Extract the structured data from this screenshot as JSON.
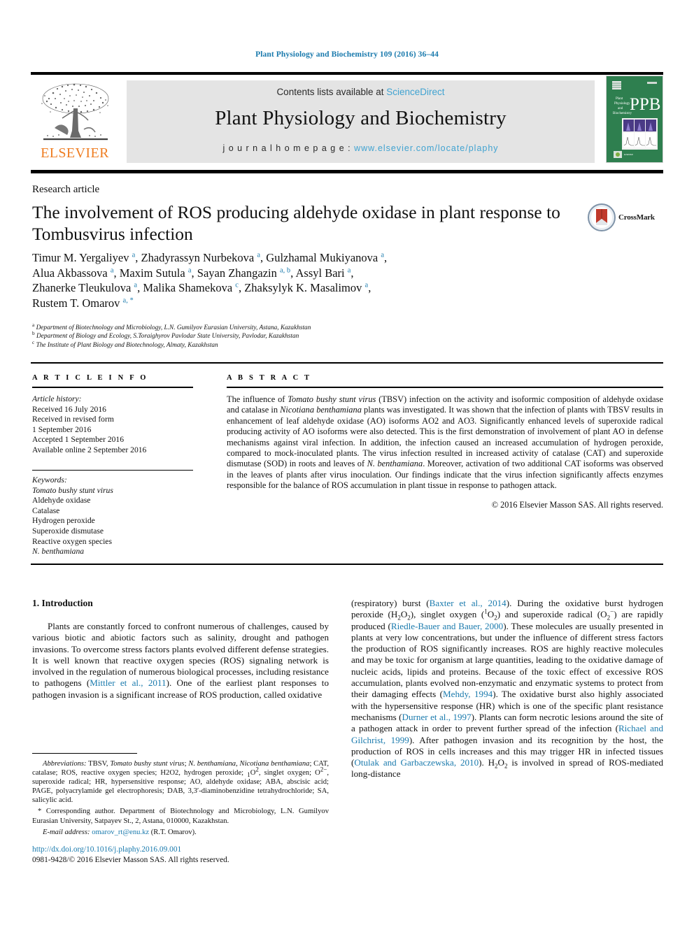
{
  "running_head": "Plant Physiology and Biochemistry 109 (2016) 36–44",
  "masthead": {
    "publisher_name": "ELSEVIER",
    "contents_prefix": "Contents lists available at ",
    "contents_link": "ScienceDirect",
    "journal_title": "Plant Physiology and Biochemistry",
    "homepage_prefix": "j o u r n a l   h o m e p a g e :  ",
    "homepage_url": "www.elsevier.com/locate/plaphy",
    "cover_abbrev": "PPB",
    "cover_subtitle": "Plant Physiology and Biochemistry"
  },
  "article": {
    "type": "Research article",
    "title": "The involvement of ROS producing aldehyde oxidase in plant response to Tombusvirus infection",
    "crossmark_label": "CrossMark",
    "authors_html": "Timur M. Yergaliyev <sup>a</sup>, Zhadyrassyn Nurbekova <sup>a</sup>, Gulzhamal Mukiyanova <sup>a</sup>,<br>Alua Akbassova <sup>a</sup>, Maxim Sutula <sup>a</sup>, Sayan Zhangazin <sup>a, b</sup>, Assyl Bari <sup>a</sup>,<br>Zhanerke Tleukulova <sup>a</sup>, Malika Shamekova <sup>c</sup>, Zhaksylyk K. Masalimov <sup>a</sup>,<br>Rustem T. Omarov <sup>a, *</sup>",
    "affiliations": [
      {
        "marker": "a",
        "text": "Department of Biotechnology and Microbiology, L.N. Gumilyov Eurasian University, Astana, Kazakhstan"
      },
      {
        "marker": "b",
        "text": "Department of Biology and Ecology, S.Toraighyrov Pavlodar State University, Pavlodar, Kazakhstan"
      },
      {
        "marker": "c",
        "text": "The Institute of Plant Biology and Biotechnology, Almaty, Kazakhstan"
      }
    ]
  },
  "article_info": {
    "heading": "A R T I C L E  I N F O",
    "history_label": "Article history:",
    "history": [
      "Received 16 July 2016",
      "Received in revised form",
      "1 September 2016",
      "Accepted 1 September 2016",
      "Available online 2 September 2016"
    ],
    "keywords_label": "Keywords:",
    "keywords": [
      "Tomato bushy stunt virus",
      "Aldehyde oxidase",
      "Catalase",
      "Hydrogen peroxide",
      "Superoxide dismutase",
      "Reactive oxygen species",
      "N. benthamiana"
    ]
  },
  "abstract": {
    "heading": "A B S T R A C T",
    "text_html": "The influence of <i>Tomato bushy stunt virus</i> (TBSV) infection on the activity and isoformic composition of aldehyde oxidase and catalase in <i>Nicotiana benthamiana</i> plants was investigated. It was shown that the infection of plants with TBSV results in enhancement of leaf aldehyde oxidase (AO) isoforms AO2 and AO3. Significantly enhanced levels of superoxide radical producing activity of AO isoforms were also detected. This is the first demonstration of involvement of plant AO in defense mechanisms against viral infection. In addition, the infection caused an increased accumulation of hydrogen peroxide, compared to mock-inoculated plants. The virus infection resulted in increased activity of catalase (CAT) and superoxide dismutase (SOD) in roots and leaves of <i>N. benthamiana</i>. Moreover, activation of two additional CAT isoforms was observed in the leaves of plants after virus inoculation. Our findings indicate that the virus infection significantly affects enzymes responsible for the balance of ROS accumulation in plant tissue in response to pathogen attack.",
    "copyright": "© 2016 Elsevier Masson SAS. All rights reserved."
  },
  "body": {
    "section_title": "1. Introduction",
    "left_paragraph_html": "Plants are constantly forced to confront numerous of challenges, caused by various biotic and abiotic factors such as salinity, drought and pathogen invasions. To overcome stress factors plants evolved different defense strategies. It is well known that reactive oxygen species (ROS) signaling network is involved in the regulation of numerous biological processes, including resistance to pathogens (<span class=\"ref\">Mittler et al., 2011</span>). One of the earliest plant responses to pathogen invasion is a significant increase of ROS production, called oxidative",
    "right_paragraph_html": "(respiratory) burst (<span class=\"ref\">Baxter et al., 2014</span>). During the oxidative burst hydrogen peroxide (H<sub>2</sub>O<sub>2</sub>), singlet oxygen (<sup>1</sup>O<sub>2</sub>) and superoxide radical (O<sub>2</sub><sup>&minus;</sup>) are rapidly produced (<span class=\"ref\">Riedle-Bauer and Bauer, 2000</span>). These molecules are usually presented in plants at very low concentrations, but under the influence of different stress factors the production of ROS significantly increases. ROS are highly reactive molecules and may be toxic for organism at large quantities, leading to the oxidative damage of nucleic acids, lipids and proteins. Because of the toxic effect of excessive ROS accumulation, plants evolved non-enzymatic and enzymatic systems to protect from their damaging effects (<span class=\"ref\">Mehdy, 1994</span>). The oxidative burst also highly associated with the hypersensitive response (HR) which is one of the specific plant resistance mechanisms (<span class=\"ref\">Durner et al., 1997</span>). Plants can form necrotic lesions around the site of a pathogen attack in order to prevent further spread of the infection (<span class=\"ref\">Richael and Gilchrist, 1999</span>). After pathogen invasion and its recognition by the host, the production of ROS in cells increases and this may trigger HR in infected tissues (<span class=\"ref\">Otulak and Garbaczewska, 2010</span>). H<sub>2</sub>O<sub>2</sub> is involved in spread of ROS-mediated long-distance"
  },
  "footnotes": {
    "abbreviations_html": "<i>Abbreviations:</i> TBSV, <i>Tomato bushy stunt virus</i>; <i>N. benthamiana</i>, <i>Nicotiana benthamiana</i>; CAT, catalase; ROS, reactive oxygen species; H2O2, hydrogen peroxide; <sub>1</sub>O<sup>2</sup>, singlet oxygen; O<sup>2&minus;</sup>, superoxide radical; HR, hypersensitive response; AO, aldehyde oxidase; ABA, abscisic acid; PAGE, polyacrylamide gel electrophoresis; DAB, 3,3′-diaminobenzidine tetrahydrochloride; SA, salicylic acid.",
    "corresponding_html": "* Corresponding author. Department of Biotechnology and Microbiology, L.N. Gumilyov Eurasian University, Satpayev St., 2, Astana, 010000, Kazakhstan.",
    "email_label": "E-mail address:",
    "email_link": "omarov_rt@enu.kz",
    "email_suffix": "(R.T. Omarov)."
  },
  "doi_block": {
    "doi_url": "http://dx.doi.org/10.1016/j.plaphy.2016.09.001",
    "issn_line": "0981-9428/© 2016 Elsevier Masson SAS. All rights reserved."
  },
  "colors": {
    "link_blue": "#1a7aad",
    "sciencedirect_blue": "#41a3d1",
    "elsevier_orange": "#ef7d22",
    "cover_green": "#2e7f4f",
    "band_gray": "#e4e4e4"
  }
}
